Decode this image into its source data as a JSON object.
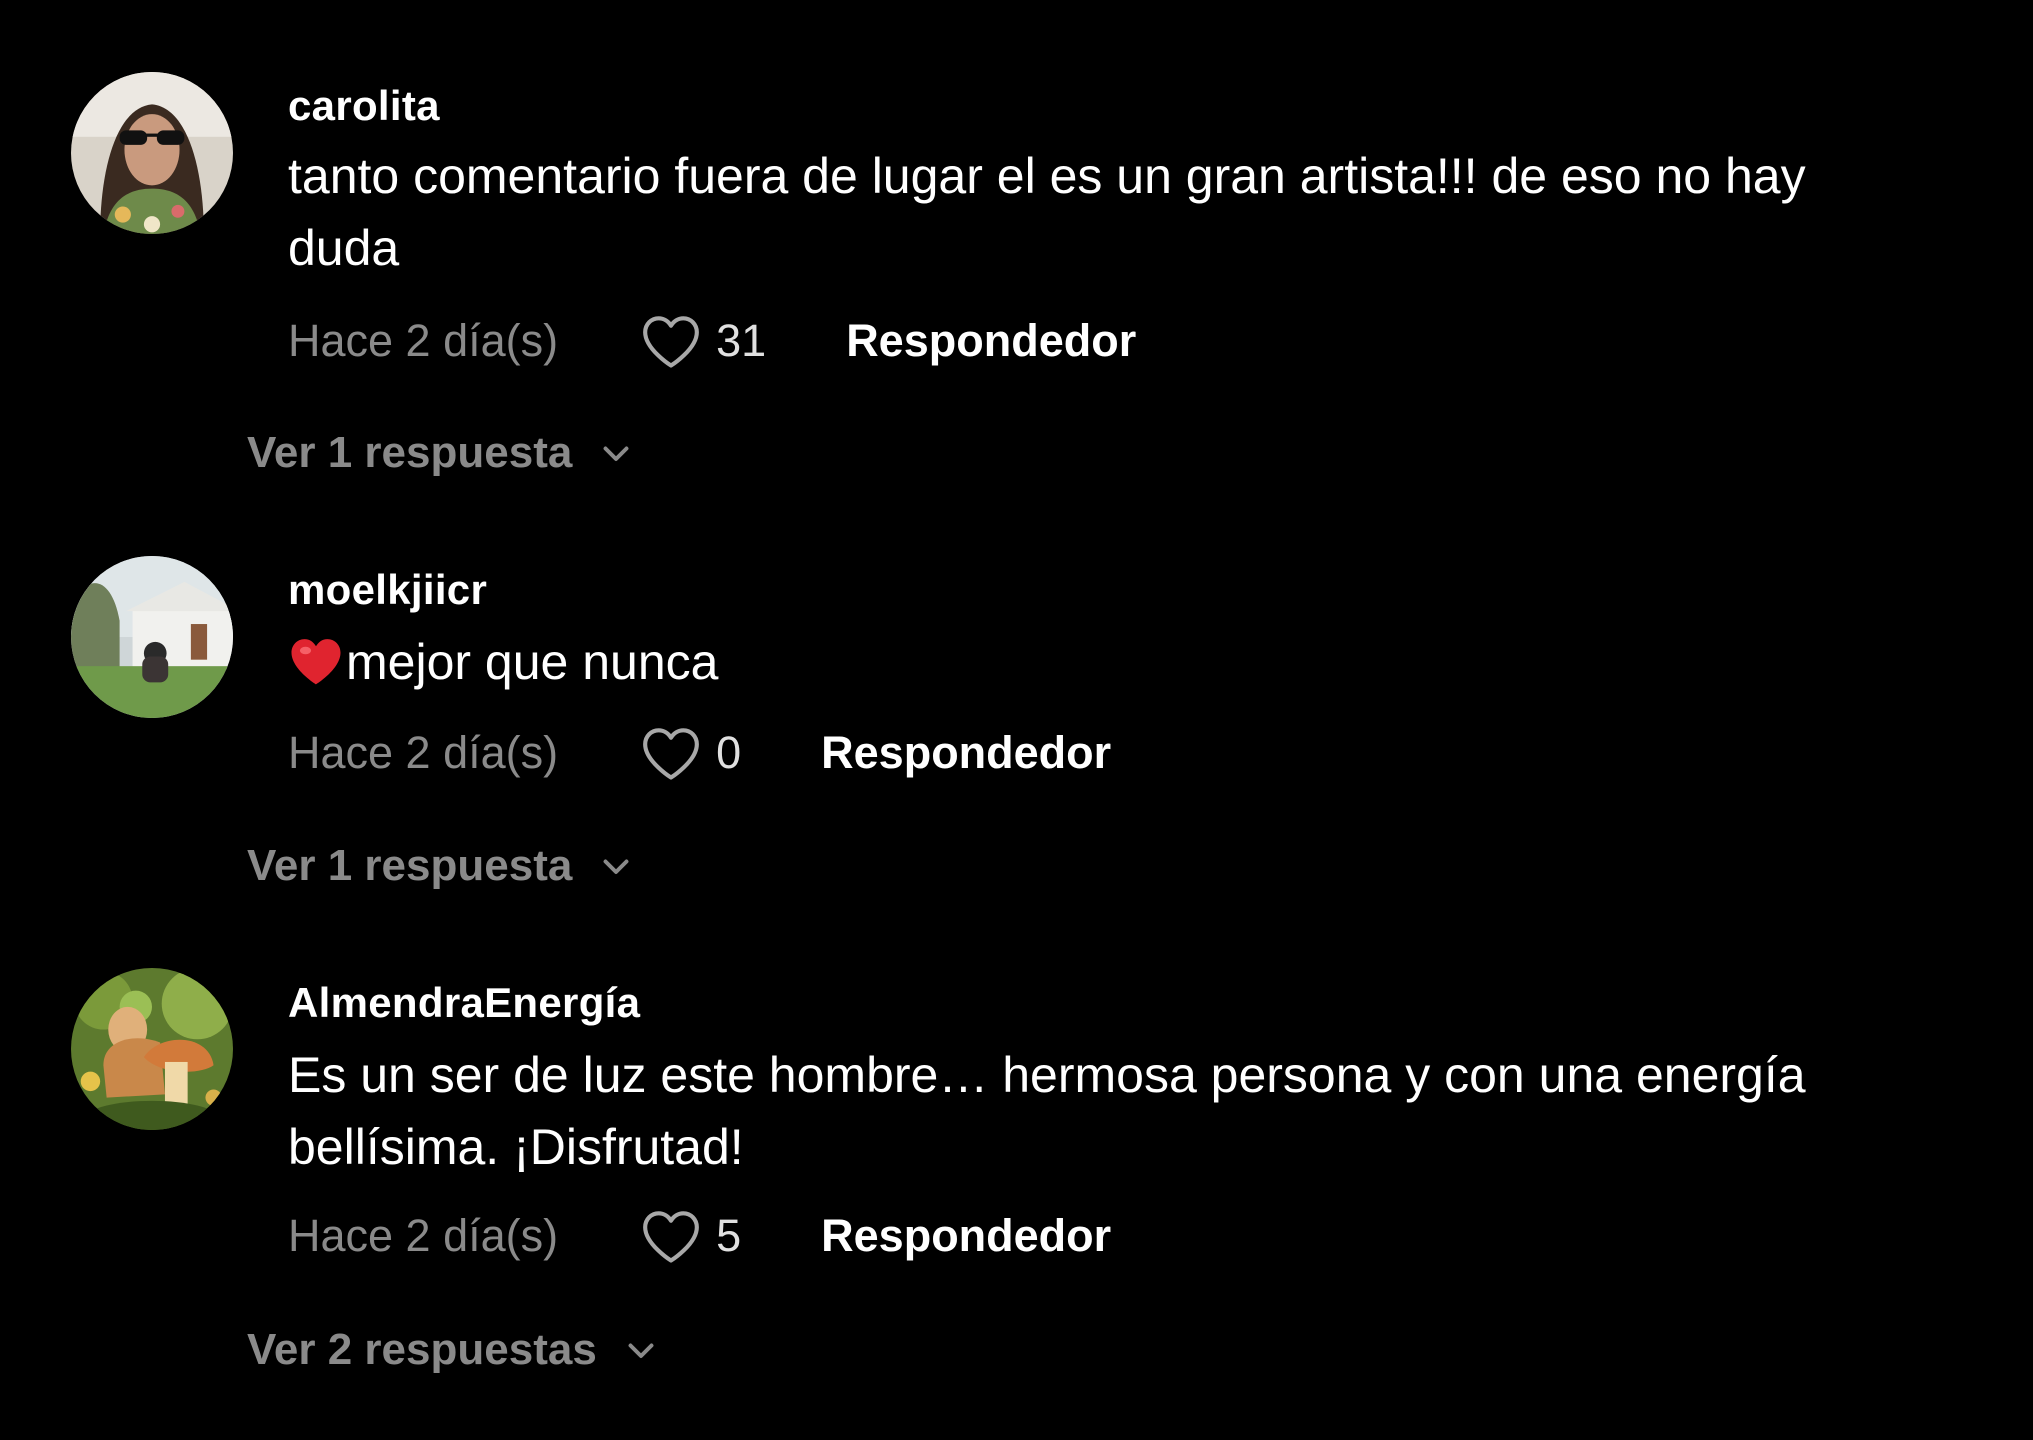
{
  "comments": [
    {
      "username": "carolita",
      "text": "tanto comentario fuera de lugar el es un gran artista!!! de eso no hay duda",
      "emoji": "",
      "timestamp": "Hace 2 día(s)",
      "likes": "31",
      "reply_label": "Respondedor",
      "view_replies": "Ver 1 respuesta"
    },
    {
      "username": "moelkjiicr",
      "text": "mejor que nunca",
      "emoji": "❤️",
      "timestamp": "Hace 2 día(s)",
      "likes": "0",
      "reply_label": "Respondedor",
      "view_replies": "Ver 1 respuesta"
    },
    {
      "username": "AlmendraEnergía",
      "text": "Es un ser de luz este hombre… hermosa persona y con una energía bellísima. ¡Disfrutad!",
      "emoji": "",
      "timestamp": "Hace 2 día(s)",
      "likes": "5",
      "reply_label": "Respondedor",
      "view_replies": "Ver 2 respuestas"
    }
  ],
  "icons": {
    "like": "heart-outline-icon",
    "expand": "chevron-down-icon",
    "emoji": "red-heart-emoji"
  },
  "colors": {
    "background": "#000000",
    "primary_text": "#ffffff",
    "secondary_text": "#8a8a8a"
  }
}
